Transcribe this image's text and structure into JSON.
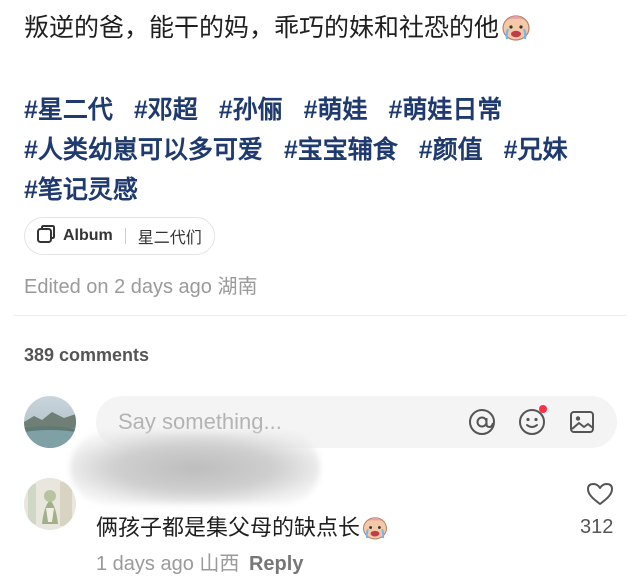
{
  "post": {
    "title": "叛逆的爸，能干的妈，乖巧的妹和社恐的他",
    "hashtags": [
      "#星二代",
      "#邓超",
      "#孙俪",
      "#萌娃",
      "#萌娃日常",
      "#人类幼崽可以多可爱",
      "#宝宝辅食",
      "#颜值",
      "#兄妹",
      "#笔记灵感"
    ]
  },
  "album": {
    "label": "Album",
    "name": "星二代们"
  },
  "meta": {
    "edited": "Edited on 2 days ago",
    "location": "湖南"
  },
  "comments": {
    "count_label": "389 comments",
    "input_placeholder": "Say something..."
  },
  "comment": {
    "text": "俩孩子都是集父母的缺点长",
    "time": "1 days ago",
    "location": "山西",
    "reply_label": "Reply",
    "likes": "312"
  },
  "icons": {
    "title_emoji": "crying-face-icon",
    "album": "album-icon",
    "mention": "at-icon",
    "emoji": "smiley-icon",
    "image": "image-icon",
    "like": "heart-outline-icon"
  },
  "colors": {
    "hashtag": "#1e3a6e",
    "notification_dot": "#ff2d49"
  }
}
